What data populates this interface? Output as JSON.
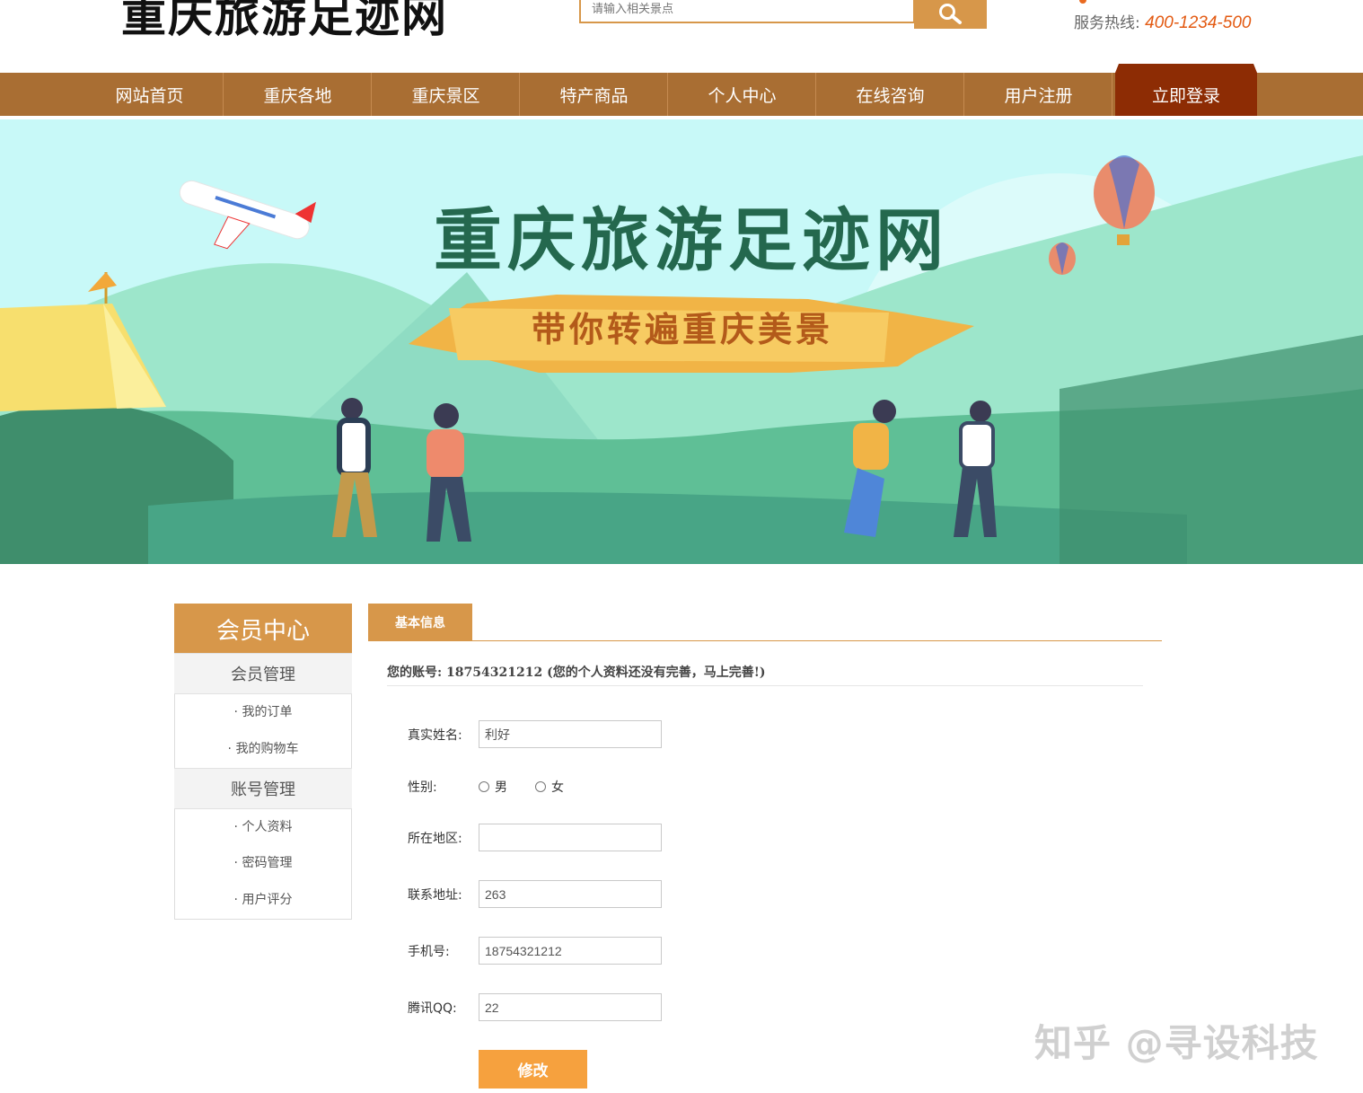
{
  "header": {
    "logo_text": "重庆旅游足迹网",
    "search_placeholder": "请输入相关景点",
    "hotline_label": "服务热线:",
    "hotline_number": "400-1234-500"
  },
  "nav": {
    "items": [
      "网站首页",
      "重庆各地",
      "重庆景区",
      "特产商品",
      "个人中心",
      "在线咨询",
      "用户注册"
    ],
    "active": "立即登录"
  },
  "banner": {
    "title": "重庆旅游足迹网",
    "subtitle": "带你转遍重庆美景"
  },
  "sidebar": {
    "title": "会员中心",
    "groups": [
      {
        "label": "会员管理",
        "links": [
          "· 我的订单",
          "· 我的购物车"
        ]
      },
      {
        "label": "账号管理",
        "links": [
          "· 个人资料",
          "· 密码管理",
          "· 用户评分"
        ]
      }
    ]
  },
  "main": {
    "tab": "基本信息",
    "account_label": "您的账号:",
    "account_number": "18754321212",
    "account_note": "(您的个人资料还没有完善，马上完善!)",
    "fields": {
      "name_label": "真实姓名:",
      "name_value": "利好",
      "gender_label": "性别:",
      "gender_male": "男",
      "gender_female": "女",
      "region_label": "所在地区:",
      "region_value": "",
      "address_label": "联系地址:",
      "address_value": "263",
      "phone_label": "手机号:",
      "phone_value": "18754321212",
      "qq_label": "腾讯QQ:",
      "qq_value": "22"
    },
    "submit_label": "修改"
  },
  "watermark": "知乎 @寻设科技",
  "colors": {
    "nav": "#a96e33",
    "accent": "#d7974a",
    "active_nav": "#8d2c04",
    "submit": "#f6a13e",
    "hotline": "#e35a12"
  }
}
